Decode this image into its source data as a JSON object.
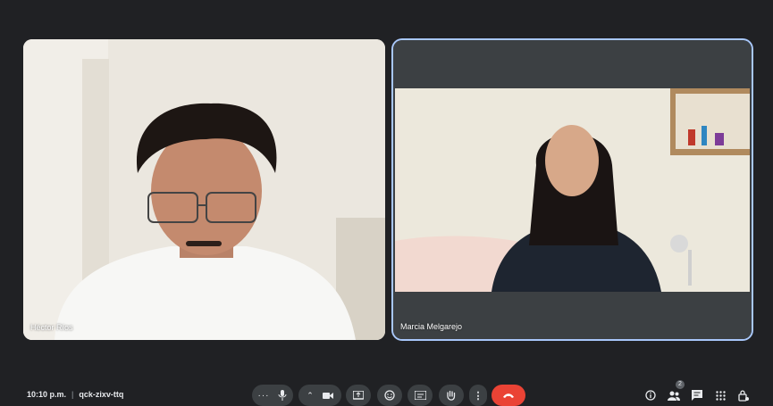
{
  "participants": [
    {
      "name": "Héctor Ríos"
    },
    {
      "name": "Marcia Melgarejo"
    }
  ],
  "meeting": {
    "time": "10:10 p.m.",
    "code": "qck-zixv-ttq"
  },
  "people_count": "2",
  "colors": {
    "background": "#202124",
    "control": "#3c4043",
    "end_call": "#ea4335",
    "active_border": "#a8c7fa"
  },
  "icons": {
    "more-options": "more-options-icon",
    "mic": "mic-icon",
    "camera": "camera-icon",
    "present": "present-screen-icon",
    "emoji": "emoji-icon",
    "captions": "captions-icon",
    "raise-hand": "raise-hand-icon",
    "end-call": "end-call-icon",
    "info": "info-icon",
    "people": "people-icon",
    "chat": "chat-icon",
    "activities": "activities-icon",
    "host-controls": "host-controls-icon"
  }
}
